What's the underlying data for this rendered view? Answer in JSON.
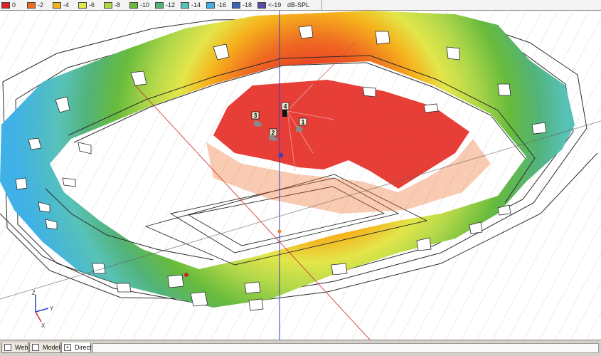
{
  "legend": {
    "items": [
      {
        "label": "0",
        "color": "#e01f23"
      },
      {
        "label": "-2",
        "color": "#ef6a22"
      },
      {
        "label": "-4",
        "color": "#f6b21c"
      },
      {
        "label": "-6",
        "color": "#e3e64a"
      },
      {
        "label": "-8",
        "color": "#b2d84a"
      },
      {
        "label": "-10",
        "color": "#67bb3c"
      },
      {
        "label": "-12",
        "color": "#52b37a"
      },
      {
        "label": "-14",
        "color": "#58c2b8"
      },
      {
        "label": "-16",
        "color": "#3fb1e6"
      },
      {
        "label": "-18",
        "color": "#3a63b4"
      },
      {
        "label": "<-19",
        "color": "#5b4aa3"
      }
    ],
    "unit": "dB-SPL"
  },
  "speakers": [
    "1",
    "2",
    "3",
    "4"
  ],
  "axes": {
    "y": "Y",
    "x": "X",
    "z": "Z"
  },
  "tabs": [
    {
      "label": "Web",
      "icon": "page-icon",
      "active": false
    },
    {
      "label": "Model",
      "icon": "page-icon",
      "active": false
    },
    {
      "label": "Direct",
      "icon": "plus-icon",
      "active": true
    }
  ]
}
